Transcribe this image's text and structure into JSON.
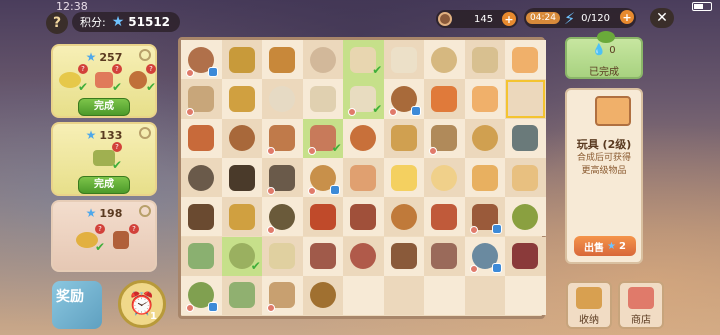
{
  "status": {
    "time": "12:38"
  },
  "topbar": {
    "help": "?",
    "score_label": "积分:",
    "score_value": "51512",
    "coins": "145",
    "timer": "04:24",
    "energy": "0/120",
    "close": "✕"
  },
  "orders": [
    {
      "points": "257",
      "status_label": "完成",
      "colors": [
        "#e6c84a",
        "#e07a5a",
        "#c0703a"
      ]
    },
    {
      "points": "133",
      "status_label": "完成",
      "colors": [
        "#a0b050"
      ]
    },
    {
      "points": "198",
      "colors": [
        "#e2b040",
        "#b0603a"
      ]
    }
  ],
  "left_bottom": {
    "reward": "奖励",
    "clock_count": "1"
  },
  "right": {
    "energy_value": "0",
    "energy_status": "已完成",
    "item_name": "玩具 (2级)",
    "item_desc": "合成后可获得更高级物品",
    "sell_label": "出售",
    "sell_price": "2",
    "storage_label": "收纳",
    "shop_label": "商店"
  },
  "board": {
    "rows": [
      [
        [
          "#b0704a",
          1,
          1,
          0
        ],
        [
          "#c89a3a",
          0,
          0,
          0
        ],
        [
          "#c8883a",
          0,
          0,
          0
        ],
        [
          "#d2b89a",
          0,
          0,
          0
        ],
        [
          "#e8d6b0",
          0,
          0,
          1
        ],
        [
          "#ece0c8",
          0,
          0,
          0
        ],
        [
          "#d6b880",
          0,
          0,
          0
        ],
        [
          "#d8c090",
          0,
          0,
          0
        ],
        [
          "#f0b06a",
          0,
          0,
          0
        ]
      ],
      [
        [
          "#c8a67a",
          0,
          1,
          0
        ],
        [
          "#d0a040",
          0,
          0,
          0
        ],
        [
          "#e6dac4",
          0,
          0,
          0
        ],
        [
          "#e0d0b0",
          0,
          0,
          0
        ],
        [
          "#e8dcc0",
          0,
          1,
          1
        ],
        [
          "#a86a3a",
          1,
          1,
          0
        ],
        [
          "#e07a3a",
          0,
          0,
          0
        ],
        [
          "#f0b06a",
          0,
          0,
          0
        ],
        [
          "",
          0,
          0,
          0
        ]
      ],
      [
        [
          "#c86a3a",
          0,
          0,
          0
        ],
        [
          "#a8683a",
          0,
          0,
          0
        ],
        [
          "#c07a4a",
          0,
          1,
          0
        ],
        [
          "#c87a5a",
          0,
          1,
          1
        ],
        [
          "#c8703a",
          0,
          0,
          0
        ],
        [
          "#d0a050",
          0,
          0,
          0
        ],
        [
          "#b08a5a",
          0,
          1,
          0
        ],
        [
          "#d0a050",
          0,
          0,
          0
        ],
        [
          "#6a7a7a",
          0,
          0,
          0
        ]
      ],
      [
        [
          "#6a5a4a",
          0,
          0,
          0
        ],
        [
          "#4a3a2a",
          0,
          0,
          0
        ],
        [
          "#6a5a4a",
          0,
          1,
          0
        ],
        [
          "#c8904a",
          1,
          1,
          0
        ],
        [
          "#e0a070",
          0,
          0,
          0
        ],
        [
          "#f4d060",
          0,
          0,
          0
        ],
        [
          "#f0d08a",
          0,
          0,
          0
        ],
        [
          "#e8b060",
          0,
          0,
          0
        ],
        [
          "#e8c080",
          0,
          0,
          0
        ]
      ],
      [
        [
          "#6a4a30",
          0,
          0,
          0
        ],
        [
          "#d0a040",
          0,
          0,
          0
        ],
        [
          "#6a5a3a",
          0,
          1,
          0
        ],
        [
          "#c04a2a",
          0,
          0,
          0
        ],
        [
          "#a0503a",
          0,
          0,
          0
        ],
        [
          "#c07a3a",
          0,
          0,
          0
        ],
        [
          "#c05a3a",
          0,
          0,
          0
        ],
        [
          "#9a5a3a",
          1,
          1,
          0
        ],
        [
          "#8aa040",
          0,
          0,
          0
        ]
      ],
      [
        [
          "#8ab070",
          0,
          0,
          0
        ],
        [
          "#9ab060",
          0,
          0,
          1
        ],
        [
          "#e0d0a0",
          0,
          0,
          0
        ],
        [
          "#a05a4a",
          0,
          0,
          0
        ],
        [
          "#b05a4a",
          0,
          0,
          0
        ],
        [
          "#8a5a3a",
          0,
          0,
          0
        ],
        [
          "#9a6a5a",
          0,
          0,
          0
        ],
        [
          "#6a8aa0",
          1,
          1,
          0
        ],
        [
          "#8a3a3a",
          0,
          0,
          0
        ]
      ],
      [
        [
          "#80a050",
          1,
          1,
          0
        ],
        [
          "#90b070",
          0,
          0,
          0
        ],
        [
          "#c8a070",
          0,
          1,
          0
        ],
        [
          "#a07030",
          0,
          0,
          0
        ]
      ]
    ]
  }
}
